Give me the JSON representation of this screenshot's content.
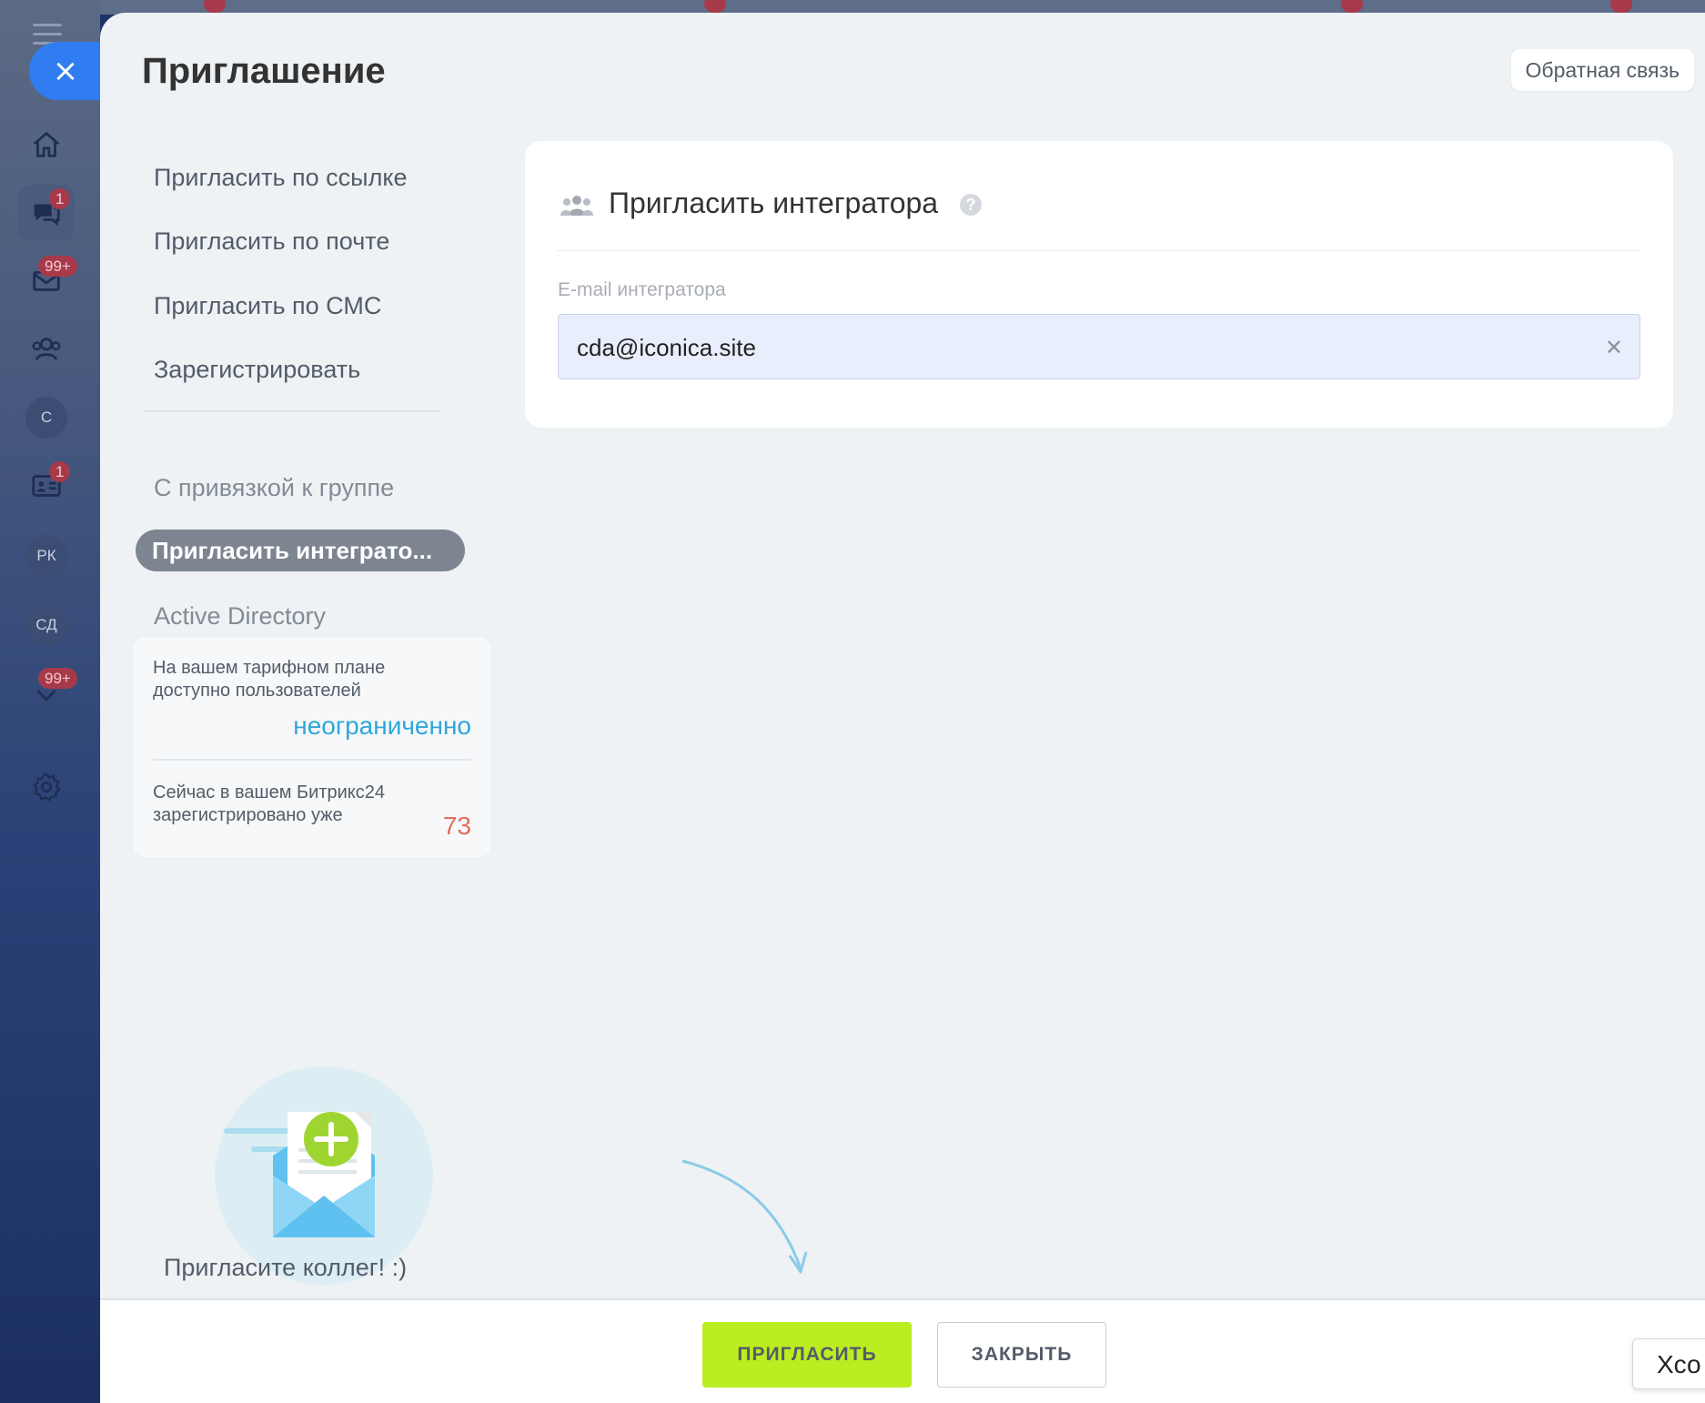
{
  "rail": {
    "badges": {
      "chat": "1",
      "mail": "99+",
      "cards": "1",
      "tasks": "99+"
    },
    "circles": {
      "c": "С",
      "rk": "РК",
      "sd": "СД"
    }
  },
  "panel": {
    "title": "Приглашение",
    "feedback_label": "Обратная связь"
  },
  "menu": {
    "items": [
      "Пригласить по ссылке",
      "Пригласить по почте",
      "Пригласить по СМС",
      "Зарегистрировать"
    ],
    "group_item": "С привязкой к группе",
    "active_item": "Пригласить интеграто...",
    "ad_item": "Active Directory"
  },
  "limits": {
    "available_text": "На вашем тарифном плане доступно пользователей",
    "available_value": "неограниченно",
    "registered_text": "Сейчас в вашем Битрикс24 зарегистрировано уже",
    "registered_value": "73"
  },
  "promo": {
    "caption": "Пригласите коллег! :)"
  },
  "card": {
    "title": "Пригласить интегратора",
    "help": "?",
    "field_label": "E-mail интегратора",
    "field_value": "cda@iconica.site"
  },
  "footer": {
    "invite_label": "ПРИГЛАСИТЬ",
    "close_label": "ЗАКРЫТЬ",
    "tip_text": "Хсо"
  },
  "colors": {
    "accent_green": "#bbed21",
    "link_blue": "#2fa6da",
    "count_red": "#e36d5e",
    "close_blue": "#2f7df0"
  }
}
